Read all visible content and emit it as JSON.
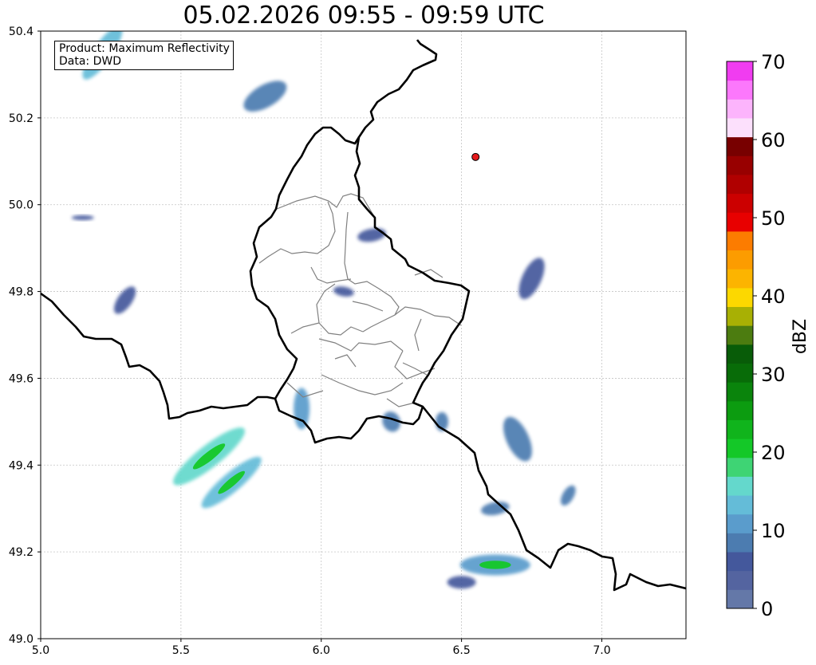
{
  "title": "05.02.2026 09:55 - 09:59 UTC",
  "info_box": {
    "product_line": "Product: Maximum Reflectivity",
    "data_line": "Data: DWD"
  },
  "chart_data": {
    "type": "heatmap",
    "title": "05.02.2026 09:55 - 09:59 UTC",
    "xlim": [
      5.0,
      7.3
    ],
    "ylim": [
      49.0,
      50.4
    ],
    "x_ticks": [
      "5.0",
      "5.5",
      "6.0",
      "6.5",
      "7.0"
    ],
    "y_ticks": [
      "49.0",
      "49.2",
      "49.4",
      "49.6",
      "49.8",
      "50.0",
      "50.2",
      "50.4"
    ],
    "grid": true,
    "marker": {
      "lon": 6.55,
      "lat": 50.11,
      "color": "#e41a1c"
    },
    "colorbar": {
      "label": "dBZ",
      "range": [
        0,
        70
      ],
      "step": 2.5,
      "tick_labels": [
        "0",
        "10",
        "20",
        "30",
        "40",
        "50",
        "60",
        "70"
      ],
      "colors": [
        "#6478a8",
        "#5464a0",
        "#44589c",
        "#4c7cb0",
        "#5a9ccc",
        "#64bcd8",
        "#64d8cc",
        "#3ed474",
        "#14c828",
        "#10b41c",
        "#0c9c10",
        "#0a840c",
        "#086c08",
        "#085c08",
        "#4c7c10",
        "#a8b004",
        "#fcd800",
        "#fcb400",
        "#fc9c00",
        "#fc7c00",
        "#e80000",
        "#cc0000",
        "#b00000",
        "#980000",
        "#780000",
        "#fce0fc",
        "#fcb4fc",
        "#fc78fc",
        "#f03cf0"
      ]
    },
    "echoes": [
      {
        "lon": 5.6,
        "lat": 49.42,
        "dbz": 15,
        "core_dbz": 22
      },
      {
        "lon": 5.68,
        "lat": 49.36,
        "dbz": 14,
        "core_dbz": 20
      },
      {
        "lon": 6.62,
        "lat": 49.17,
        "dbz": 12,
        "core_dbz": 22
      },
      {
        "lon": 5.93,
        "lat": 49.53,
        "dbz": 11
      },
      {
        "lon": 5.22,
        "lat": 50.35,
        "dbz": 13
      },
      {
        "lon": 5.3,
        "lat": 49.78,
        "dbz": 7
      },
      {
        "lon": 5.15,
        "lat": 49.97,
        "dbz": 6
      },
      {
        "lon": 5.8,
        "lat": 50.25,
        "dbz": 8
      },
      {
        "lon": 6.18,
        "lat": 49.93,
        "dbz": 7
      },
      {
        "lon": 6.08,
        "lat": 49.8,
        "dbz": 6
      },
      {
        "lon": 6.25,
        "lat": 49.5,
        "dbz": 8
      },
      {
        "lon": 6.75,
        "lat": 49.83,
        "dbz": 7
      },
      {
        "lon": 6.7,
        "lat": 49.46,
        "dbz": 9
      },
      {
        "lon": 6.62,
        "lat": 49.3,
        "dbz": 8
      },
      {
        "lon": 6.88,
        "lat": 49.33,
        "dbz": 8
      },
      {
        "lon": 6.5,
        "lat": 49.13,
        "dbz": 7
      },
      {
        "lon": 6.43,
        "lat": 49.5,
        "dbz": 9
      }
    ]
  }
}
